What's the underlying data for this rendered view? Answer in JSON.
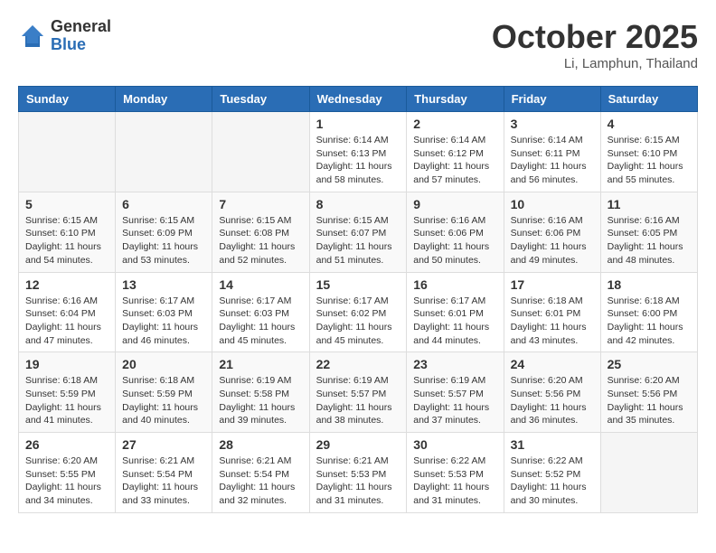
{
  "header": {
    "logo_general": "General",
    "logo_blue": "Blue",
    "month_title": "October 2025",
    "location": "Li, Lamphun, Thailand"
  },
  "weekdays": [
    "Sunday",
    "Monday",
    "Tuesday",
    "Wednesday",
    "Thursday",
    "Friday",
    "Saturday"
  ],
  "weeks": [
    [
      {
        "day": "",
        "info": ""
      },
      {
        "day": "",
        "info": ""
      },
      {
        "day": "",
        "info": ""
      },
      {
        "day": "1",
        "info": "Sunrise: 6:14 AM\nSunset: 6:13 PM\nDaylight: 11 hours\nand 58 minutes."
      },
      {
        "day": "2",
        "info": "Sunrise: 6:14 AM\nSunset: 6:12 PM\nDaylight: 11 hours\nand 57 minutes."
      },
      {
        "day": "3",
        "info": "Sunrise: 6:14 AM\nSunset: 6:11 PM\nDaylight: 11 hours\nand 56 minutes."
      },
      {
        "day": "4",
        "info": "Sunrise: 6:15 AM\nSunset: 6:10 PM\nDaylight: 11 hours\nand 55 minutes."
      }
    ],
    [
      {
        "day": "5",
        "info": "Sunrise: 6:15 AM\nSunset: 6:10 PM\nDaylight: 11 hours\nand 54 minutes."
      },
      {
        "day": "6",
        "info": "Sunrise: 6:15 AM\nSunset: 6:09 PM\nDaylight: 11 hours\nand 53 minutes."
      },
      {
        "day": "7",
        "info": "Sunrise: 6:15 AM\nSunset: 6:08 PM\nDaylight: 11 hours\nand 52 minutes."
      },
      {
        "day": "8",
        "info": "Sunrise: 6:15 AM\nSunset: 6:07 PM\nDaylight: 11 hours\nand 51 minutes."
      },
      {
        "day": "9",
        "info": "Sunrise: 6:16 AM\nSunset: 6:06 PM\nDaylight: 11 hours\nand 50 minutes."
      },
      {
        "day": "10",
        "info": "Sunrise: 6:16 AM\nSunset: 6:06 PM\nDaylight: 11 hours\nand 49 minutes."
      },
      {
        "day": "11",
        "info": "Sunrise: 6:16 AM\nSunset: 6:05 PM\nDaylight: 11 hours\nand 48 minutes."
      }
    ],
    [
      {
        "day": "12",
        "info": "Sunrise: 6:16 AM\nSunset: 6:04 PM\nDaylight: 11 hours\nand 47 minutes."
      },
      {
        "day": "13",
        "info": "Sunrise: 6:17 AM\nSunset: 6:03 PM\nDaylight: 11 hours\nand 46 minutes."
      },
      {
        "day": "14",
        "info": "Sunrise: 6:17 AM\nSunset: 6:03 PM\nDaylight: 11 hours\nand 45 minutes."
      },
      {
        "day": "15",
        "info": "Sunrise: 6:17 AM\nSunset: 6:02 PM\nDaylight: 11 hours\nand 45 minutes."
      },
      {
        "day": "16",
        "info": "Sunrise: 6:17 AM\nSunset: 6:01 PM\nDaylight: 11 hours\nand 44 minutes."
      },
      {
        "day": "17",
        "info": "Sunrise: 6:18 AM\nSunset: 6:01 PM\nDaylight: 11 hours\nand 43 minutes."
      },
      {
        "day": "18",
        "info": "Sunrise: 6:18 AM\nSunset: 6:00 PM\nDaylight: 11 hours\nand 42 minutes."
      }
    ],
    [
      {
        "day": "19",
        "info": "Sunrise: 6:18 AM\nSunset: 5:59 PM\nDaylight: 11 hours\nand 41 minutes."
      },
      {
        "day": "20",
        "info": "Sunrise: 6:18 AM\nSunset: 5:59 PM\nDaylight: 11 hours\nand 40 minutes."
      },
      {
        "day": "21",
        "info": "Sunrise: 6:19 AM\nSunset: 5:58 PM\nDaylight: 11 hours\nand 39 minutes."
      },
      {
        "day": "22",
        "info": "Sunrise: 6:19 AM\nSunset: 5:57 PM\nDaylight: 11 hours\nand 38 minutes."
      },
      {
        "day": "23",
        "info": "Sunrise: 6:19 AM\nSunset: 5:57 PM\nDaylight: 11 hours\nand 37 minutes."
      },
      {
        "day": "24",
        "info": "Sunrise: 6:20 AM\nSunset: 5:56 PM\nDaylight: 11 hours\nand 36 minutes."
      },
      {
        "day": "25",
        "info": "Sunrise: 6:20 AM\nSunset: 5:56 PM\nDaylight: 11 hours\nand 35 minutes."
      }
    ],
    [
      {
        "day": "26",
        "info": "Sunrise: 6:20 AM\nSunset: 5:55 PM\nDaylight: 11 hours\nand 34 minutes."
      },
      {
        "day": "27",
        "info": "Sunrise: 6:21 AM\nSunset: 5:54 PM\nDaylight: 11 hours\nand 33 minutes."
      },
      {
        "day": "28",
        "info": "Sunrise: 6:21 AM\nSunset: 5:54 PM\nDaylight: 11 hours\nand 32 minutes."
      },
      {
        "day": "29",
        "info": "Sunrise: 6:21 AM\nSunset: 5:53 PM\nDaylight: 11 hours\nand 31 minutes."
      },
      {
        "day": "30",
        "info": "Sunrise: 6:22 AM\nSunset: 5:53 PM\nDaylight: 11 hours\nand 31 minutes."
      },
      {
        "day": "31",
        "info": "Sunrise: 6:22 AM\nSunset: 5:52 PM\nDaylight: 11 hours\nand 30 minutes."
      },
      {
        "day": "",
        "info": ""
      }
    ]
  ]
}
